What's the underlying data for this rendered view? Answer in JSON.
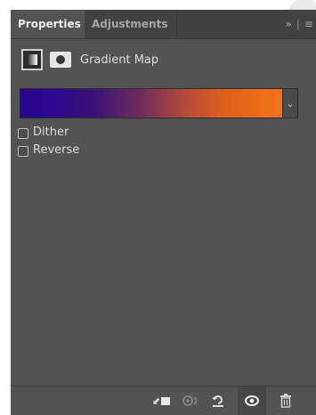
{
  "tabs": [
    {
      "label": "Properties",
      "active": true
    },
    {
      "label": "Adjustments",
      "active": false
    }
  ],
  "tab_controls": {
    "expand": "»",
    "menu": "≡"
  },
  "panel": {
    "title": "Gradient Map"
  },
  "gradient": {
    "colors": [
      "#240689",
      "#3b1177",
      "#6b2b5e",
      "#b04a3a",
      "#e0601c",
      "#f4741a"
    ],
    "dropdown_glyph": "⌄"
  },
  "options": [
    {
      "label": "Dither",
      "checked": false
    },
    {
      "label": "Reverse",
      "checked": false
    }
  ],
  "bottom_icons": [
    "clip-to-layer-icon",
    "view-previous-state-icon",
    "reset-icon",
    "visibility-eye-icon",
    "trash-icon"
  ]
}
